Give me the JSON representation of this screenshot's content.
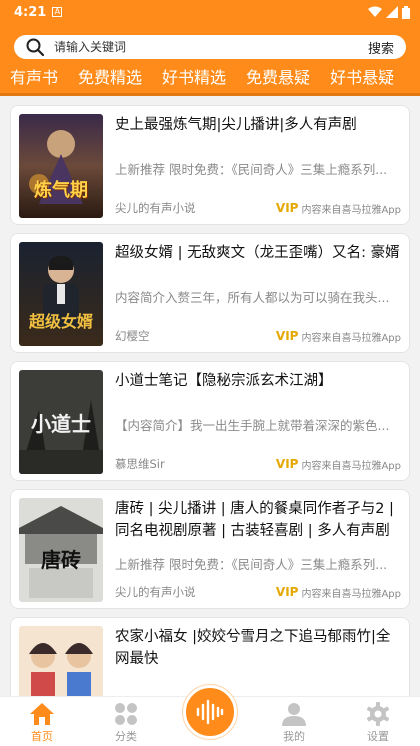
{
  "status_bar": {
    "time": "4:21",
    "notification": "A"
  },
  "search": {
    "placeholder": "请输入关键词",
    "button": "搜索"
  },
  "tabs": [
    {
      "label": "有声书",
      "active": false
    },
    {
      "label": "免费精选",
      "active": false
    },
    {
      "label": "好书精选",
      "active": true
    },
    {
      "label": "免费悬疑",
      "active": false
    },
    {
      "label": "好书悬疑",
      "active": false
    }
  ],
  "books": [
    {
      "title": "史上最强炼气期|尖儿播讲|多人有声剧",
      "desc": "上新推荐 限时免费：《民间奇人》三集上瘾系列...",
      "author": "尖儿的有声小说",
      "vip": "VIP",
      "source": "内容来自喜马拉雅App",
      "cover_text": "炼气期"
    },
    {
      "title": "超级女婿 | 无敌爽文（龙王歪嘴）又名: 豪婿",
      "desc": "内容简介入赘三年，所有人都以为可以骑在我头...",
      "author": "幻樱空",
      "vip": "VIP",
      "source": "内容来自喜马拉雅App",
      "cover_text": "超级女婿"
    },
    {
      "title": "小道士笔记【隐秘宗派玄术江湖】",
      "desc": "【内容简介】我一出生手腕上就带着深深的紫色...",
      "author": "慕思维Sir",
      "vip": "VIP",
      "source": "内容来自喜马拉雅App",
      "cover_text": "小道士"
    },
    {
      "title": "唐砖 | 尖儿播讲 | 唐人的餐桌同作者孑与2 | 同名电视剧原著 | 古装轻喜剧 | 多人有声剧",
      "desc": "上新推荐 限时免费：《民间奇人》三集上瘾系列...",
      "author": "尖儿的有声小说",
      "vip": "VIP",
      "source": "内容来自喜马拉雅App",
      "cover_text": "唐砖"
    },
    {
      "title": "农家小福女 |姣姣兮雪月之下追马郁雨竹|全网最快",
      "desc": "",
      "author": "",
      "vip": "",
      "source": "",
      "cover_text": ""
    }
  ],
  "nav": {
    "home": "首页",
    "category": "分类",
    "mine": "我的",
    "settings": "设置"
  },
  "colors": {
    "accent": "#ff8c1a",
    "vip": "#e6a800"
  }
}
